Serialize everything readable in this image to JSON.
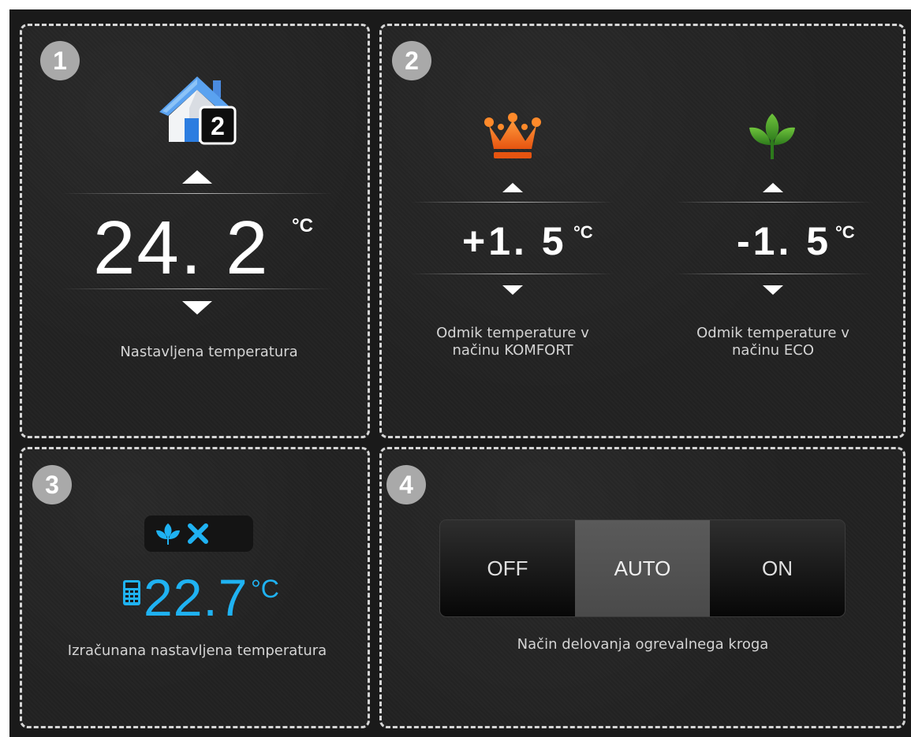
{
  "panels": {
    "set_temperature": {
      "badge": "1",
      "house_badge": "2",
      "value": "24. 2",
      "unit": "°C",
      "label": "Nastavljena temperatura"
    },
    "offsets": {
      "badge": "2",
      "comfort": {
        "icon": "crown-icon",
        "value": "+1. 5",
        "unit": "°C",
        "label_line1": "Odmik temperature v",
        "label_line2": "načinu KOMFORT"
      },
      "eco": {
        "icon": "leaf-icon",
        "value": "-1. 5",
        "unit": "°C",
        "label_line1": "Odmik temperature v",
        "label_line2": "načinu ECO"
      }
    },
    "calculated": {
      "badge": "3",
      "value": "22.7",
      "unit": "°C",
      "label": "Izračunana nastavljena temperatura"
    },
    "mode": {
      "badge": "4",
      "options": [
        "OFF",
        "AUTO",
        "ON"
      ],
      "selected": "AUTO",
      "label": "Način delovanja ogrevalnega kroga"
    }
  },
  "colors": {
    "accent_blue": "#1fb2f2",
    "comfort_orange": "#f06a1e",
    "eco_green": "#4aa02c",
    "badge_gray": "#a9a9a9"
  }
}
